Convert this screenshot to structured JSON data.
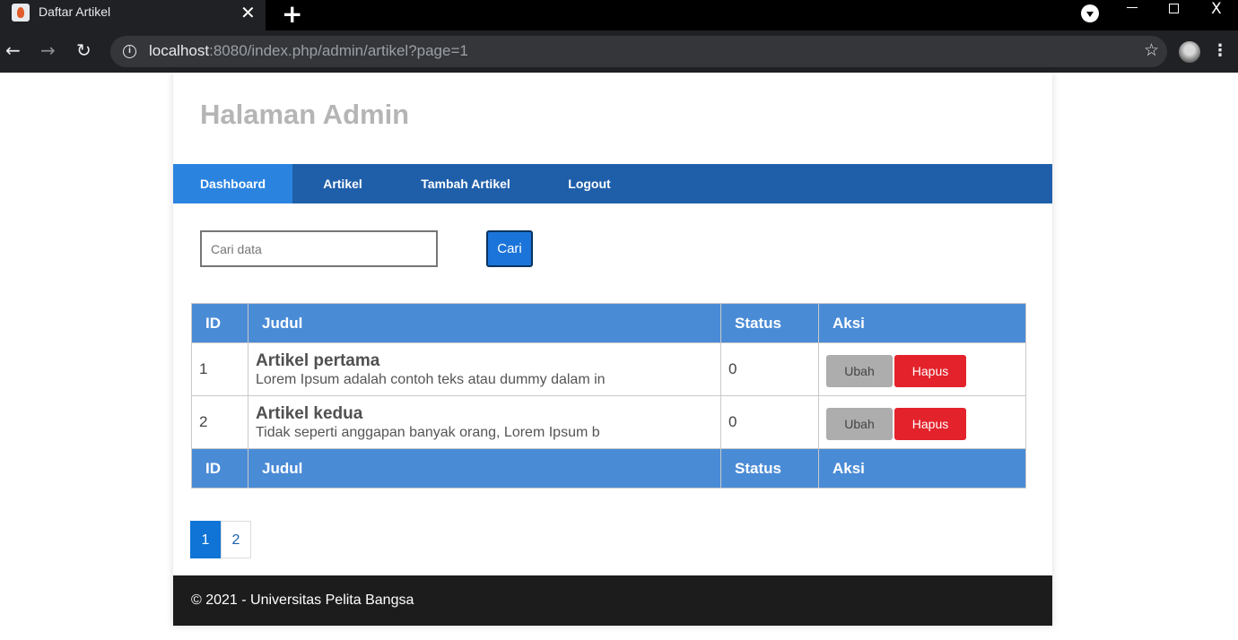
{
  "browser": {
    "tab_title": "Daftar Artikel",
    "tab_close": "✕",
    "new_tab": "+",
    "url_host": "localhost",
    "url_rest": ":8080/index.php/admin/artikel?page=1",
    "back": "←",
    "forward": "→",
    "reload": "↻",
    "star": "☆",
    "menu": "⋮",
    "win_close": "X",
    "info": "i"
  },
  "header": {
    "title": "Halaman Admin"
  },
  "nav": {
    "items": [
      {
        "label": "Dashboard",
        "active": true
      },
      {
        "label": "Artikel"
      },
      {
        "label": "Tambah Artikel"
      },
      {
        "label": "Logout"
      }
    ]
  },
  "search": {
    "placeholder": "Cari data",
    "value": "",
    "button": "Cari"
  },
  "table": {
    "headers": [
      "ID",
      "Judul",
      "Status",
      "Aksi"
    ],
    "rows": [
      {
        "id": "1",
        "title": "Artikel pertama",
        "excerpt": "Lorem Ipsum adalah contoh teks atau dummy dalam in",
        "status": "0",
        "edit": "Ubah",
        "delete": "Hapus"
      },
      {
        "id": "2",
        "title": "Artikel kedua",
        "excerpt": "Tidak seperti anggapan banyak orang, Lorem Ipsum b",
        "status": "0",
        "edit": "Ubah",
        "delete": "Hapus"
      }
    ]
  },
  "pagination": {
    "pages": [
      "1",
      "2"
    ],
    "current": "1"
  },
  "footer": {
    "text": "© 2021 - Universitas Pelita Bangsa"
  },
  "colors": {
    "nav": "#1f5faa",
    "nav_active": "#2b83e0",
    "table_head": "#4a8bd6",
    "danger": "#e3222b"
  }
}
